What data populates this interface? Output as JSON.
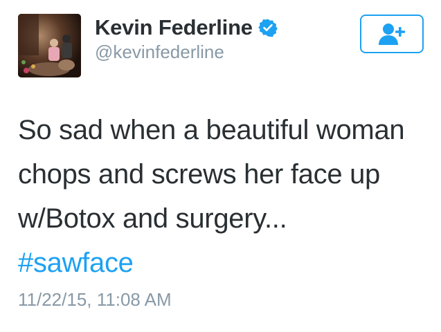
{
  "user": {
    "display_name": "Kevin Federline",
    "handle": "@kevinfederline",
    "verified": true,
    "avatar_icon": "profile-photo"
  },
  "follow_button": {
    "icon": "add-user-icon",
    "color": "#1da1f2"
  },
  "tweet": {
    "text": "So sad when a beautiful woman chops and screws her face up w/Botox and surgery...",
    "hashtag": "#sawface",
    "timestamp": "11/22/15, 11:08 AM"
  },
  "colors": {
    "text": "#292f33",
    "secondary": "#8899a6",
    "accent": "#1da1f2"
  }
}
